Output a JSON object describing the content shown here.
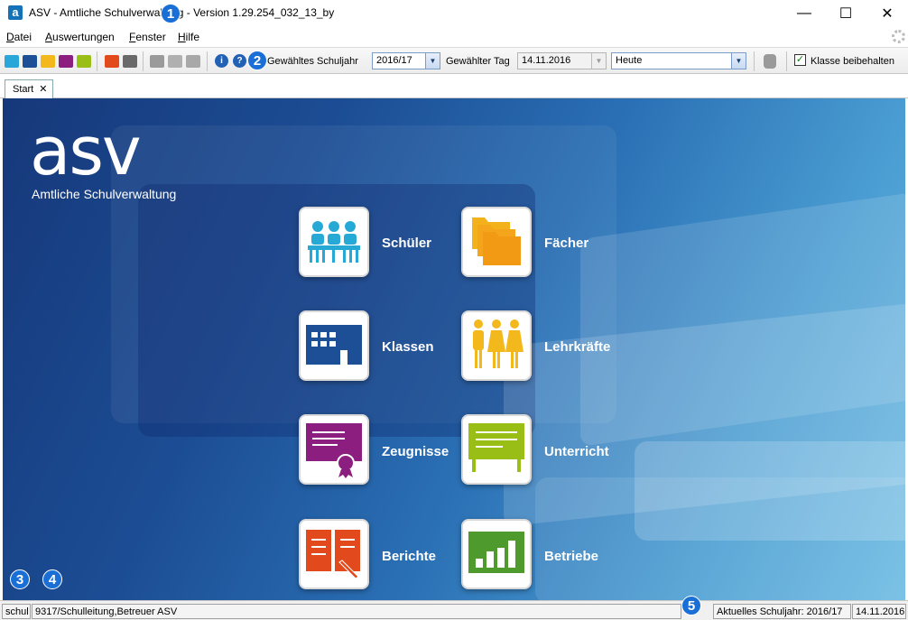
{
  "window": {
    "title": "ASV - Amtliche Schulverwaltung - Version 1.29.254_032_13_by",
    "app_icon_letter": "a",
    "controls": {
      "minimize": "—",
      "maximize": "☐",
      "close": "✕"
    }
  },
  "menu": {
    "items": [
      {
        "label": "Datei"
      },
      {
        "label": "Auswertungen"
      },
      {
        "label": "Fenster"
      },
      {
        "label": "Hilfe"
      }
    ]
  },
  "toolbar": {
    "schuljahr_label": "Gewähltes Schuljahr",
    "schuljahr_value": "2016/17",
    "tag_label": "Gewählter Tag",
    "tag_value": "14.11.2016",
    "zeitraum_value": "Heute",
    "klasse_beibehalten_label": "Klasse beibehalten",
    "klasse_beibehalten_checked": true,
    "info_icon_glyph": "i",
    "help_icon_glyph": "?"
  },
  "tabs": [
    {
      "label": "Start",
      "close_glyph": "✕"
    }
  ],
  "start_page": {
    "logo": "asv",
    "logo_subtitle": "Amtliche Schulverwaltung",
    "modules": [
      {
        "label": "Schüler",
        "icon": "students-icon",
        "color": "#27a9d5"
      },
      {
        "label": "Fächer",
        "icon": "folders-icon",
        "color": "#f39a14"
      },
      {
        "label": "Klassen",
        "icon": "building-icon",
        "color": "#1c4f96"
      },
      {
        "label": "Lehrkräfte",
        "icon": "teachers-icon",
        "color": "#f3b81b"
      },
      {
        "label": "Zeugnisse",
        "icon": "certificate-icon",
        "color": "#8b1e7f"
      },
      {
        "label": "Unterricht",
        "icon": "board-icon",
        "color": "#99bf16"
      },
      {
        "label": "Berichte",
        "icon": "report-book-icon",
        "color": "#e2491d"
      },
      {
        "label": "Betriebe",
        "icon": "bar-chart-icon",
        "color": "#4f9a2c"
      }
    ]
  },
  "statusbar": {
    "user": "schul",
    "role": "9317/Schulleitung,Betreuer ASV",
    "current_year": "Aktuelles Schuljahr: 2016/17",
    "date": "14.11.2016"
  },
  "callouts": [
    "1",
    "2",
    "3",
    "4",
    "5"
  ]
}
